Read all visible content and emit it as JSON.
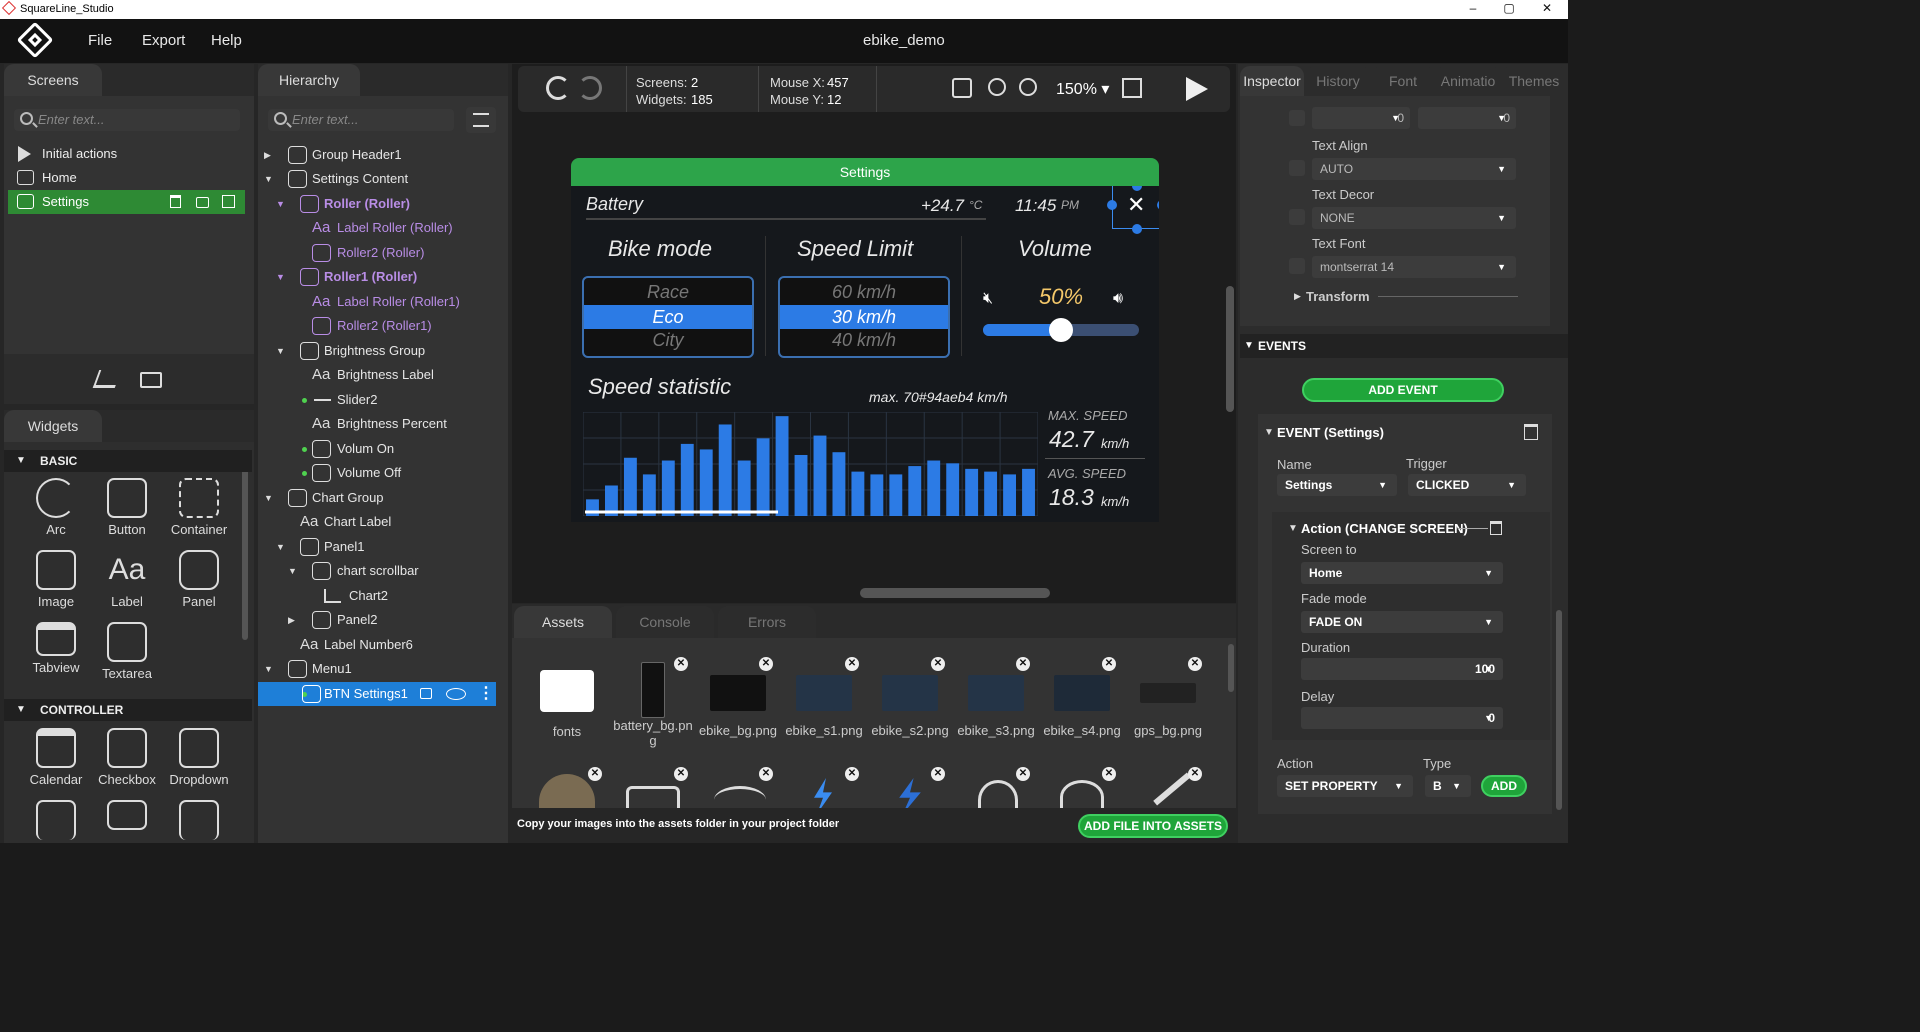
{
  "window": {
    "title": "SquareLine_Studio",
    "controls": {
      "minimize": "–",
      "maximize": "▢",
      "close": "✕"
    }
  },
  "menu": {
    "items": [
      "File",
      "Export",
      "Help"
    ],
    "project": "ebike_demo"
  },
  "screens_panel": {
    "tab": "Screens",
    "search_placeholder": "Enter text...",
    "items": [
      "Initial actions",
      "Home",
      "Settings"
    ]
  },
  "widgets_panel": {
    "tab": "Widgets",
    "basic_section": "BASIC",
    "basic": [
      "Arc",
      "Button",
      "Container",
      "Image",
      "Label",
      "Panel",
      "Tabview",
      "Textarea"
    ],
    "controller_section": "CONTROLLER",
    "controller": [
      "Calendar",
      "Checkbox",
      "Dropdown"
    ]
  },
  "hierarchy": {
    "tab": "Hierarchy",
    "search_placeholder": "Enter text...",
    "items": [
      "Group Header1",
      "Settings Content",
      "Roller (Roller)",
      "Label Roller (Roller)",
      "Roller2 (Roller)",
      "Roller1 (Roller)",
      "Label Roller (Roller1)",
      "Roller2 (Roller1)",
      "Brightness Group",
      "Brightness Label",
      "Slider2",
      "Brightness Percent",
      "Volum On",
      "Volume Off",
      "Chart Group",
      "Chart Label",
      "Panel1",
      "chart scrollbar",
      "Chart2",
      "Panel2",
      "Label Number6",
      "Menu1",
      "BTN Settings1"
    ]
  },
  "toolbar": {
    "screens_label": "Screens:",
    "screens_value": "2",
    "widgets_label": "Widgets:",
    "widgets_value": "185",
    "mousex_label": "Mouse X:",
    "mousex_value": "457",
    "mousey_label": "Mouse Y:",
    "mousey_value": "12",
    "zoom": "150%"
  },
  "device": {
    "header": "Settings",
    "battery": "Battery",
    "temp": "+24.7",
    "temp_unit": "°C",
    "time": "11:45",
    "time_suffix": "PM",
    "bike_mode_title": "Bike mode",
    "bike_modes": [
      "Race",
      "Eco",
      "City"
    ],
    "speed_limit_title": "Speed Limit",
    "speed_limits": [
      "60 km/h",
      "30 km/h",
      "40 km/h"
    ],
    "volume_title": "Volume",
    "volume_percent": "50%",
    "volume_level": 0.5,
    "speed_stat_title": "Speed statistic",
    "max_line": "max. 70#94aeb4 km/h",
    "max_speed_label": "MAX. SPEED",
    "max_speed_value": "42.7",
    "avg_speed_label": "AVG. SPEED",
    "avg_speed_value": "18.3",
    "speed_unit": "km/h",
    "bars": [
      12,
      22,
      42,
      30,
      40,
      52,
      48,
      66,
      40,
      56,
      72,
      44,
      58,
      46,
      32,
      30,
      30,
      36,
      40,
      38,
      34,
      32,
      30,
      34
    ],
    "bar_max": 75,
    "accent": "#2c7be5",
    "header_color": "#2da44a"
  },
  "bottom_panel": {
    "tabs": [
      "Assets",
      "Console",
      "Errors"
    ],
    "assets": [
      "fonts",
      "battery_bg.png",
      "ebike_bg.png",
      "ebike_s1.png",
      "ebike_s2.png",
      "ebike_s3.png",
      "ebike_s4.png",
      "gps_bg.png"
    ],
    "footer": "Copy your images into the assets folder in your project folder",
    "add_button": "ADD FILE INTO ASSETS"
  },
  "inspector": {
    "tabs": [
      "Inspector",
      "History",
      "Font",
      "Animatio",
      "Themes"
    ],
    "num_values": [
      "0",
      "0"
    ],
    "text_align_label": "Text Align",
    "text_align": "AUTO",
    "text_decor_label": "Text Decor",
    "text_decor": "NONE",
    "text_font_label": "Text Font",
    "text_font": "montserrat 14",
    "transform": "Transform",
    "events_section": "EVENTS",
    "add_event": "ADD EVENT",
    "event_title": "EVENT (Settings)",
    "name_label": "Name",
    "name_value": "Settings",
    "trigger_label": "Trigger",
    "trigger_value": "CLICKED",
    "action_title": "Action (CHANGE SCREEN)",
    "screen_to_label": "Screen to",
    "screen_to": "Home",
    "fade_label": "Fade mode",
    "fade_mode": "FADE ON",
    "duration_label": "Duration",
    "duration": "100",
    "delay_label": "Delay",
    "delay": "0",
    "action_label": "Action",
    "action_value": "SET PROPERTY",
    "type_label": "Type",
    "type_value": "B",
    "add": "ADD"
  }
}
